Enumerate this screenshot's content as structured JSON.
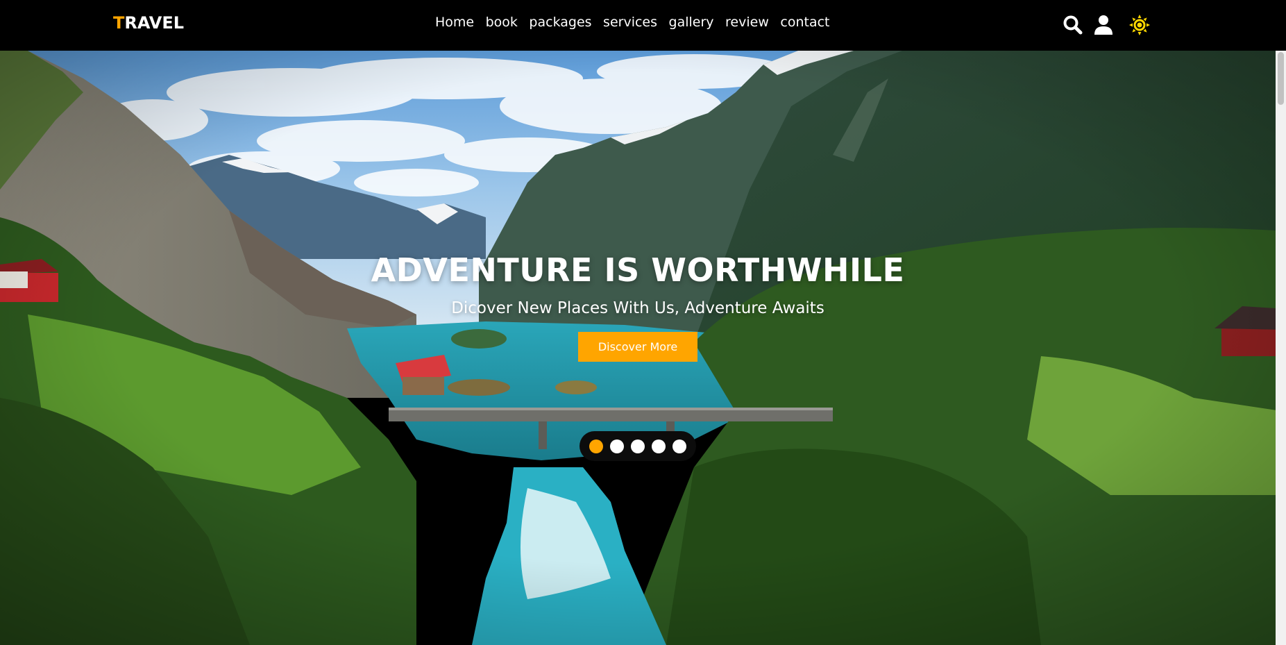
{
  "brand": {
    "logo_first": "T",
    "logo_rest": "RAVEL"
  },
  "nav": {
    "items": [
      {
        "label": "Home",
        "name": "nav-home"
      },
      {
        "label": "book",
        "name": "nav-book"
      },
      {
        "label": "packages",
        "name": "nav-packages"
      },
      {
        "label": "services",
        "name": "nav-services"
      },
      {
        "label": "gallery",
        "name": "nav-gallery"
      },
      {
        "label": "review",
        "name": "nav-review"
      },
      {
        "label": "contact",
        "name": "nav-contact"
      }
    ]
  },
  "header_icons": [
    "search-icon",
    "user-icon",
    "sun-icon"
  ],
  "hero": {
    "title": "ADVENTURE IS WORTHWHILE",
    "subtitle": "Dicover New Places With Us, Adventure Awaits",
    "button_label": "Discover More",
    "slides": {
      "count": 5,
      "active": 0
    }
  },
  "colors": {
    "accent": "#ffa500",
    "header_bg": "#000000",
    "text": "#ffffff"
  }
}
